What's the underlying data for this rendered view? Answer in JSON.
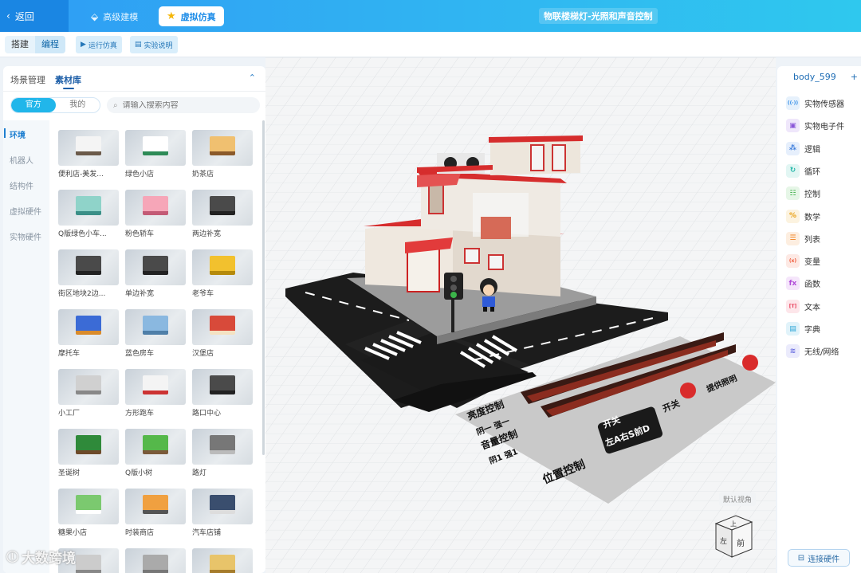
{
  "topbar": {
    "back_label": "返回",
    "tab_modeling": "高级建模",
    "tab_simulation": "虚拟仿真",
    "project_title": "物联楼梯灯-光照和声音控制"
  },
  "toolbar": {
    "build_label": "搭建",
    "code_label": "编程",
    "run_label": "运行仿真",
    "guide_label": "实验说明"
  },
  "left_panel": {
    "tab_scene": "场景管理",
    "tab_assets": "素材库",
    "toggle_official": "官方",
    "toggle_mine": "我的",
    "search_placeholder": "请输入搜索内容",
    "categories": [
      "环境",
      "机器人",
      "结构件",
      "虚拟硬件",
      "实物硬件"
    ],
    "assets": [
      "便利店-美发...",
      "绿色小店",
      "奶茶店",
      "Q版绿色小车...",
      "粉色轿车",
      "两边补宽",
      "街区地块2边...",
      "单边补宽",
      "老爷车",
      "摩托车",
      "蓝色房车",
      "汉堡店",
      "小工厂",
      "方形跑车",
      "路口中心",
      "圣诞树",
      "Q版小树",
      "路灯",
      "糖果小店",
      "时装商店",
      "汽车店铺",
      "",
      "",
      ""
    ]
  },
  "scene": {
    "board_texts": [
      "亮度控制",
      "阴一 强一",
      "音量控制",
      "阴1 强1",
      "位置控制",
      "开关",
      "左A右S前D",
      "开关",
      "提供照明"
    ],
    "default_view_label": "默认视角",
    "cube_top": "上",
    "cube_front": "前",
    "cube_left": "左"
  },
  "right_panel": {
    "tab_label": "body_599",
    "add_symbol": "+",
    "items": [
      {
        "label": "实物传感器",
        "icon": "sensor-icon",
        "glyph": "((·))",
        "color": "#2f8be6",
        "bg": "#e6f1fc"
      },
      {
        "label": "实物电子件",
        "icon": "chip-icon",
        "glyph": "▣",
        "color": "#8a56d8",
        "bg": "#efe7fb"
      },
      {
        "label": "逻辑",
        "icon": "logic-icon",
        "glyph": "⁂",
        "color": "#3a7bdb",
        "bg": "#e6effc"
      },
      {
        "label": "循环",
        "icon": "loop-icon",
        "glyph": "↻",
        "color": "#1fb5a7",
        "bg": "#e2f6f3"
      },
      {
        "label": "控制",
        "icon": "control-icon",
        "glyph": "☷",
        "color": "#3fb04a",
        "bg": "#e6f6e7"
      },
      {
        "label": "数学",
        "icon": "math-icon",
        "glyph": "%",
        "color": "#e9a21b",
        "bg": "#fcf3e0"
      },
      {
        "label": "列表",
        "icon": "list-icon",
        "glyph": "☰",
        "color": "#f07f1a",
        "bg": "#fdeee0"
      },
      {
        "label": "变量",
        "icon": "variable-icon",
        "glyph": "(x)",
        "color": "#ef5b3c",
        "bg": "#fde9e4"
      },
      {
        "label": "函数",
        "icon": "function-icon",
        "glyph": "fx",
        "color": "#b04ad8",
        "bg": "#f5e6fb"
      },
      {
        "label": "文本",
        "icon": "text-icon",
        "glyph": "[T]",
        "color": "#e8425d",
        "bg": "#fde6ea"
      },
      {
        "label": "字典",
        "icon": "dictionary-icon",
        "glyph": "▤",
        "color": "#2aa4d6",
        "bg": "#e1f3fa"
      },
      {
        "label": "无线/网络",
        "icon": "wifi-icon",
        "glyph": "≋",
        "color": "#6b6fe0",
        "bg": "#ebebfc"
      }
    ],
    "connect_label": "连接硬件"
  },
  "watermark": {
    "text": "大数跨境"
  }
}
